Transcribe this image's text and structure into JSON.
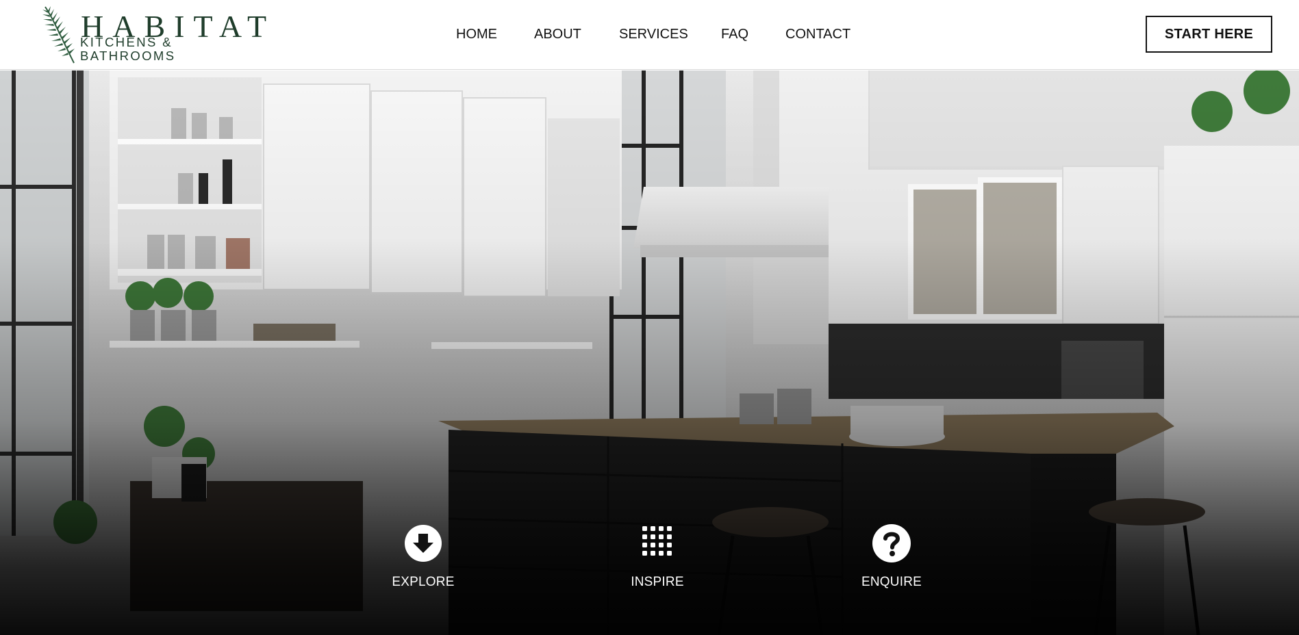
{
  "brand": {
    "name": "HABITAT",
    "tagline": "KITCHENS & BATHROOMS",
    "color": "#1f3d2b"
  },
  "nav": {
    "home": "HOME",
    "about": "ABOUT",
    "services": "SERVICES",
    "faq": "FAQ",
    "contact": "CONTACT"
  },
  "header": {
    "cta_label": "START HERE"
  },
  "hero": {
    "image_subject": "kitchen-interior",
    "actions": {
      "explore": {
        "label": "EXPLORE",
        "icon": "arrow-down-circle-icon"
      },
      "inspire": {
        "label": "INSPIRE",
        "icon": "dot-grid-icon"
      },
      "enquire": {
        "label": "ENQUIRE",
        "icon": "question-circle-icon"
      }
    }
  },
  "colors": {
    "header_bg": "#ffffff",
    "text": "#111111",
    "hero_text": "#ffffff"
  }
}
